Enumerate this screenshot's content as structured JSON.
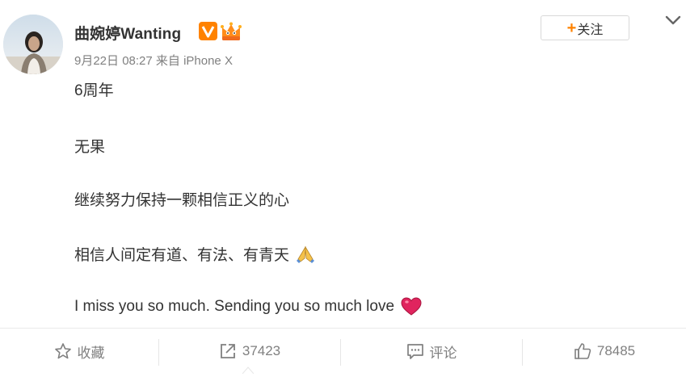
{
  "post": {
    "author": {
      "name": "曲婉婷Wanting"
    },
    "meta": "9月22日 08:27 来自 iPhone X",
    "follow": {
      "plus": "+",
      "label": "关注"
    },
    "content": [
      {
        "text": "6周年"
      },
      {
        "text": "无果"
      },
      {
        "text": "继续努力保持一颗相信正义的心"
      },
      {
        "text": "相信人间定有道、有法、有青天",
        "icon": "folded-hands-icon"
      },
      {
        "text": "I miss you so much. Sending you so much love",
        "icon": "red-heart-icon"
      }
    ]
  },
  "actions": {
    "favorite": {
      "label": "收藏",
      "icon": "star-icon"
    },
    "repost": {
      "label": "37423",
      "icon": "repost-icon"
    },
    "comment": {
      "label": "评论",
      "icon": "comment-icon"
    },
    "like": {
      "label": "78485",
      "icon": "thumbs-up-icon"
    }
  },
  "colors": {
    "accent": "#ff8200",
    "text": "#333333",
    "muted": "#808080",
    "badge_orange": "#ff8200",
    "heart_red": "#e0245e"
  }
}
